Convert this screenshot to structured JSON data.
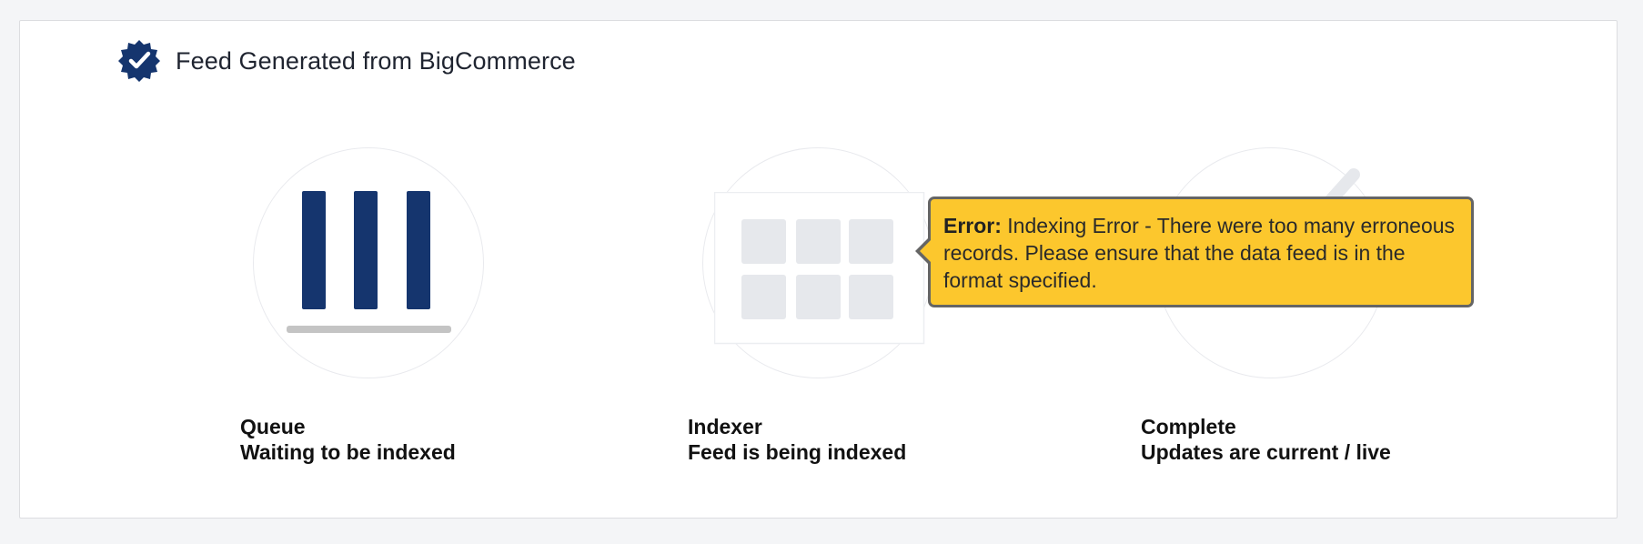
{
  "header": {
    "title": "Feed Generated from BigCommerce",
    "icon": "badge-check-icon"
  },
  "stages": [
    {
      "name": "Queue",
      "description": "Waiting to be indexed",
      "icon": "queue-bars-icon",
      "active": true
    },
    {
      "name": "Indexer",
      "description": "Feed is being indexed",
      "icon": "indexer-grid-icon",
      "active": false
    },
    {
      "name": "Complete",
      "description": "Updates are current / live",
      "icon": "checkmark-icon",
      "active": false
    }
  ],
  "tooltip": {
    "label": "Error:",
    "message": "Indexing Error - There were too many erroneous records. Please ensure that the data feed is in the format specified."
  },
  "colors": {
    "brand_navy": "#15356e",
    "tooltip_bg": "#fcc72d",
    "tooltip_border": "#656565",
    "inactive": "#e6e8ec"
  }
}
